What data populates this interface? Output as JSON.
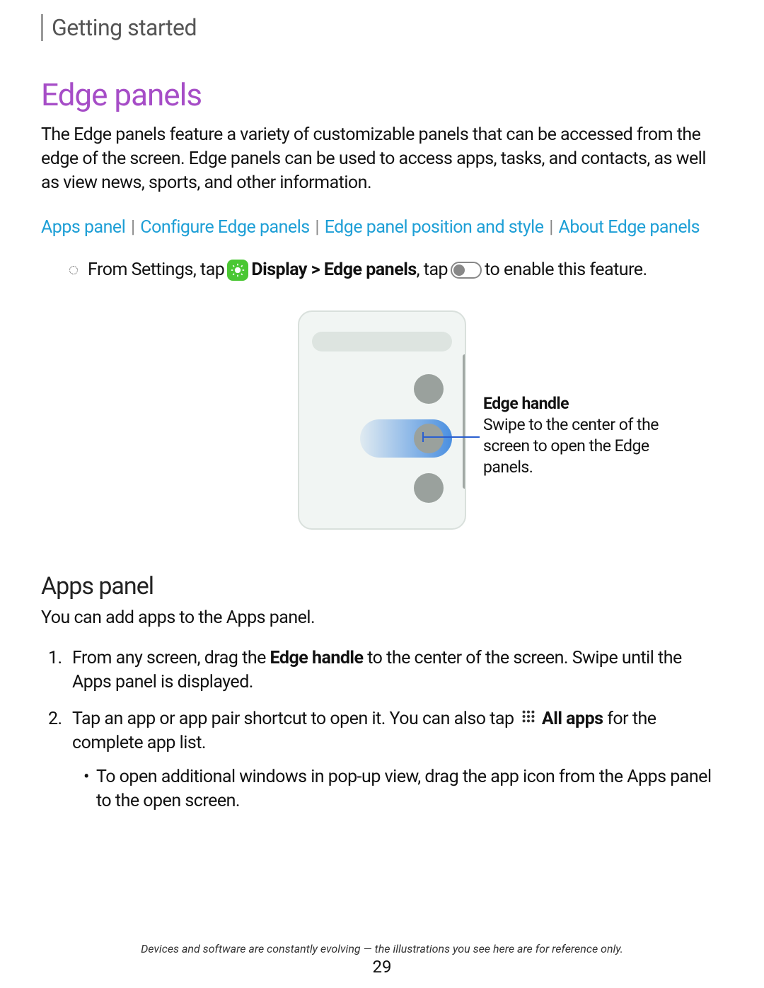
{
  "breadcrumb": "Getting started",
  "title": "Edge panels",
  "intro": "The Edge panels feature a variety of customizable panels that can be accessed from the edge of the screen. Edge panels can be used to access apps, tasks, and contacts, as well as view news, sports, and other information.",
  "links": {
    "l1": "Apps panel",
    "l2": "Configure Edge panels",
    "l3": "Edge panel position and style",
    "l4": "About Edge panels",
    "sep": "|"
  },
  "instruction": {
    "pre": "From Settings, tap",
    "bold1": "Display > Edge panels",
    "mid": ", tap",
    "post": "to enable this feature."
  },
  "callout": {
    "title": "Edge handle",
    "body": "Swipe to the center of the screen to open the Edge panels."
  },
  "section2": {
    "title": "Apps panel",
    "intro": "You can add apps to the Apps panel.",
    "step1_pre": "From any screen, drag the ",
    "step1_bold": "Edge handle",
    "step1_post": " to the center of the screen. Swipe until the Apps panel is displayed.",
    "step2_pre": "Tap an app or app pair shortcut to open it. You can also tap",
    "step2_bold": "All apps",
    "step2_post": " for the complete app list.",
    "sub1": "To open additional windows in pop-up view, drag the app icon from the Apps panel to the open screen."
  },
  "footer": "Devices and software are constantly evolving — the illustrations you see here are for reference only.",
  "page": "29"
}
